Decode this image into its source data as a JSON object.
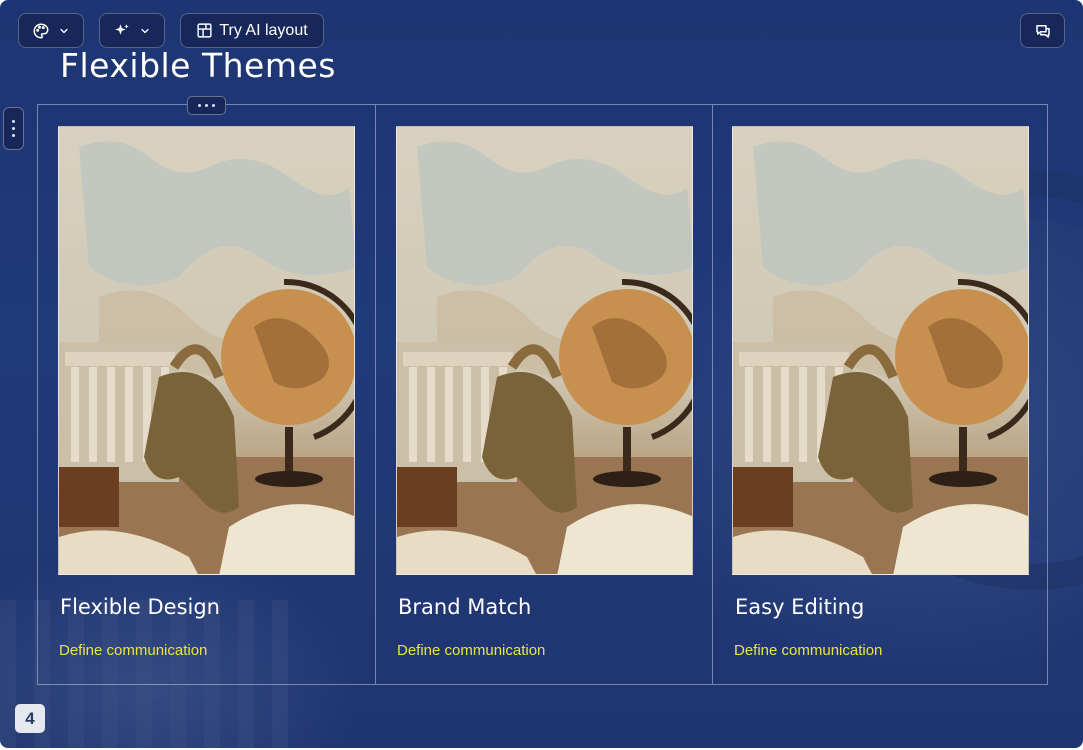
{
  "toolbar": {
    "theme_icon": "palette-icon",
    "ai_icon": "sparkle-icon",
    "layout_icon": "layout-icon",
    "ai_layout_label": "Try AI layout",
    "comment_icon": "comment-icon"
  },
  "slide": {
    "title": "Flexible Themes",
    "cards": [
      {
        "title": "Flexible Design",
        "description": "Define communication"
      },
      {
        "title": "Brand Match",
        "description": "Define communication"
      },
      {
        "title": "Easy Editing",
        "description": "Define communication"
      }
    ],
    "page_number": "4"
  },
  "colors": {
    "background": "#1f3672",
    "accent_text": "#e8e63a",
    "toolbar_button": "#17275a"
  }
}
